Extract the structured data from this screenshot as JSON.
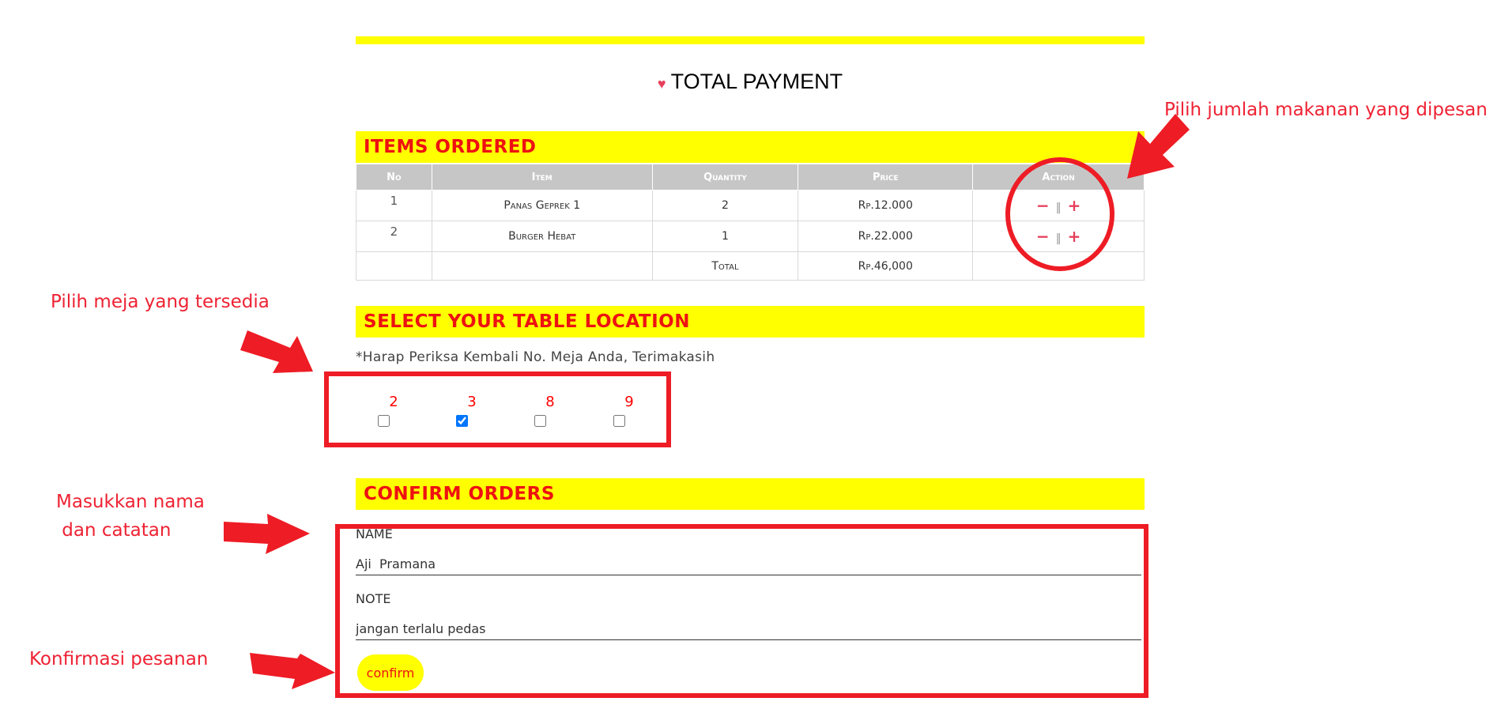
{
  "page": {
    "title": "TOTAL PAYMENT",
    "heart_icon": "♥"
  },
  "items_ordered": {
    "heading": "ITEMS ORDERED",
    "columns": [
      "No",
      "Item",
      "Quantity",
      "Price",
      "Action"
    ],
    "rows": [
      {
        "no": "1",
        "item": "Panas Geprek 1",
        "quantity": "2",
        "price": "Rp.12.000",
        "minus": "−",
        "sep": "‖",
        "plus": "+"
      },
      {
        "no": "2",
        "item": "Burger  Hebat",
        "quantity": "1",
        "price": "Rp.22.000",
        "minus": "−",
        "sep": "‖",
        "plus": "+"
      }
    ],
    "total_label": "Total",
    "total_value": "Rp.46,000"
  },
  "table_location": {
    "heading": "SELECT YOUR TABLE LOCATION",
    "note": "*Harap  Periksa  Kembali  No.  Meja Anda,  Terimakasih",
    "tables": [
      {
        "number": "2",
        "checked": false
      },
      {
        "number": "3",
        "checked": true
      },
      {
        "number": "8",
        "checked": false
      },
      {
        "number": "9",
        "checked": false
      }
    ]
  },
  "confirm_orders": {
    "heading": "CONFIRM ORDERS",
    "name_label": "NAME",
    "name_value": "Aji  Pramana",
    "note_label": "NOTE",
    "note_value": "jangan terlalu pedas",
    "confirm_label": "confirm"
  },
  "annotations": {
    "quantity": "Pilih jumlah makanan yang dipesan",
    "table": "Pilih meja yang tersedia",
    "name_line1": "Masukkan nama",
    "name_line2": " dan catatan",
    "confirm": "Konfirmasi pesanan"
  },
  "colors": {
    "accent_yellow": "#ffff00",
    "heading_red": "#ee1111",
    "annotation_red": "#ee2233",
    "action_pink": "#e63f5c"
  }
}
